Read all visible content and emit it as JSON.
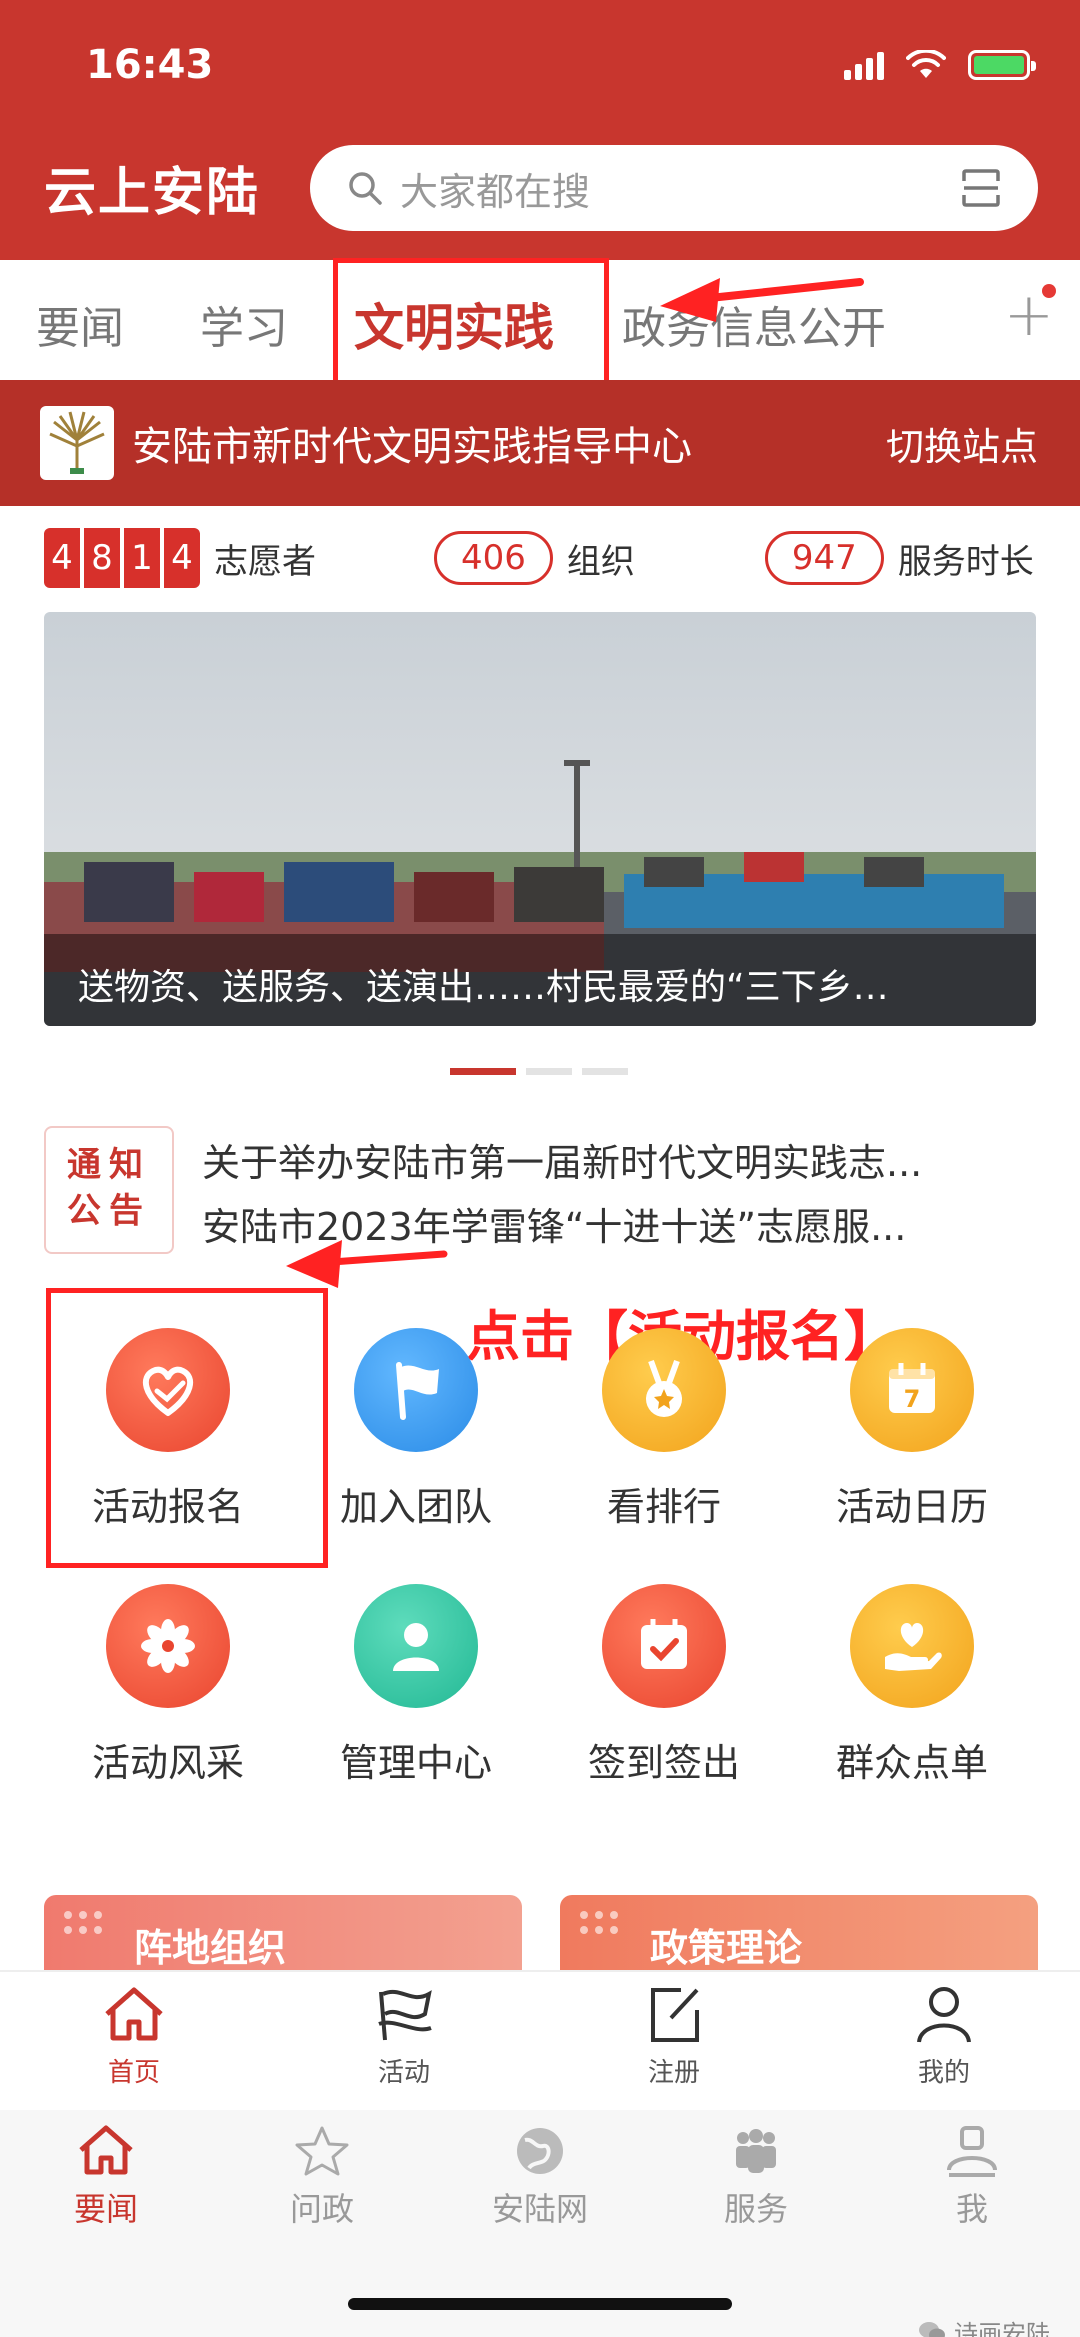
{
  "status": {
    "time": "16:43"
  },
  "header": {
    "title": "云上安陆",
    "search_placeholder": "大家都在搜"
  },
  "tabs": [
    {
      "label": "要闻"
    },
    {
      "label": "学习"
    },
    {
      "label": "文明实践",
      "active": true
    },
    {
      "label": "政务信息公开"
    }
  ],
  "center": {
    "name": "安陆市新时代文明实践指导中心",
    "switch_label": "切换站点"
  },
  "stats": {
    "volunteer_digits": [
      "4",
      "8",
      "1",
      "4"
    ],
    "volunteer_label": "志愿者",
    "org_count": "406",
    "org_label": "组织",
    "hours_count": "947",
    "hours_label": "服务时长"
  },
  "carousel": {
    "caption": "送物资、送服务、送演出……村民最爱的“三下乡…"
  },
  "notice": {
    "badge_line1": "通知",
    "badge_line2": "公告",
    "items": [
      "关于举办安陆市第一届新时代文明实践志...",
      "安陆市2023年学雷锋“十进十送”志愿服..."
    ]
  },
  "annotation": {
    "callout": "点击【活动报名】"
  },
  "grid": [
    {
      "label": "活动报名",
      "icon": "heart-hand-icon",
      "color": "#f0513d"
    },
    {
      "label": "加入团队",
      "icon": "flag-icon",
      "color": "#3a9cf0"
    },
    {
      "label": "看排行",
      "icon": "medal-icon",
      "color": "#f5a623"
    },
    {
      "label": "活动日历",
      "icon": "calendar-icon",
      "color": "#f5a623"
    },
    {
      "label": "活动风采",
      "icon": "flower-icon",
      "color": "#f0513d"
    },
    {
      "label": "管理中心",
      "icon": "user-icon",
      "color": "#2bbf9c"
    },
    {
      "label": "签到签出",
      "icon": "calendar-check-icon",
      "color": "#f0513d"
    },
    {
      "label": "群众点单",
      "icon": "hand-heart-icon",
      "color": "#f5a623"
    }
  ],
  "features": [
    {
      "label": "阵地组织"
    },
    {
      "label": "政策理论"
    }
  ],
  "nav_inner": [
    {
      "label": "首页",
      "icon": "home-icon",
      "active": true
    },
    {
      "label": "活动",
      "icon": "flag-icon"
    },
    {
      "label": "注册",
      "icon": "edit-icon"
    },
    {
      "label": "我的",
      "icon": "person-icon"
    }
  ],
  "nav_outer": [
    {
      "label": "要闻",
      "icon": "home-icon",
      "active": true
    },
    {
      "label": "问政",
      "icon": "star-icon"
    },
    {
      "label": "安陆网",
      "icon": "globe-icon"
    },
    {
      "label": "服务",
      "icon": "people-icon"
    },
    {
      "label": "我",
      "icon": "profile-icon"
    }
  ],
  "watermark": "诗画安陆",
  "colors": {
    "brand_red": "#c8362e",
    "highlight_red": "#ff2222"
  }
}
